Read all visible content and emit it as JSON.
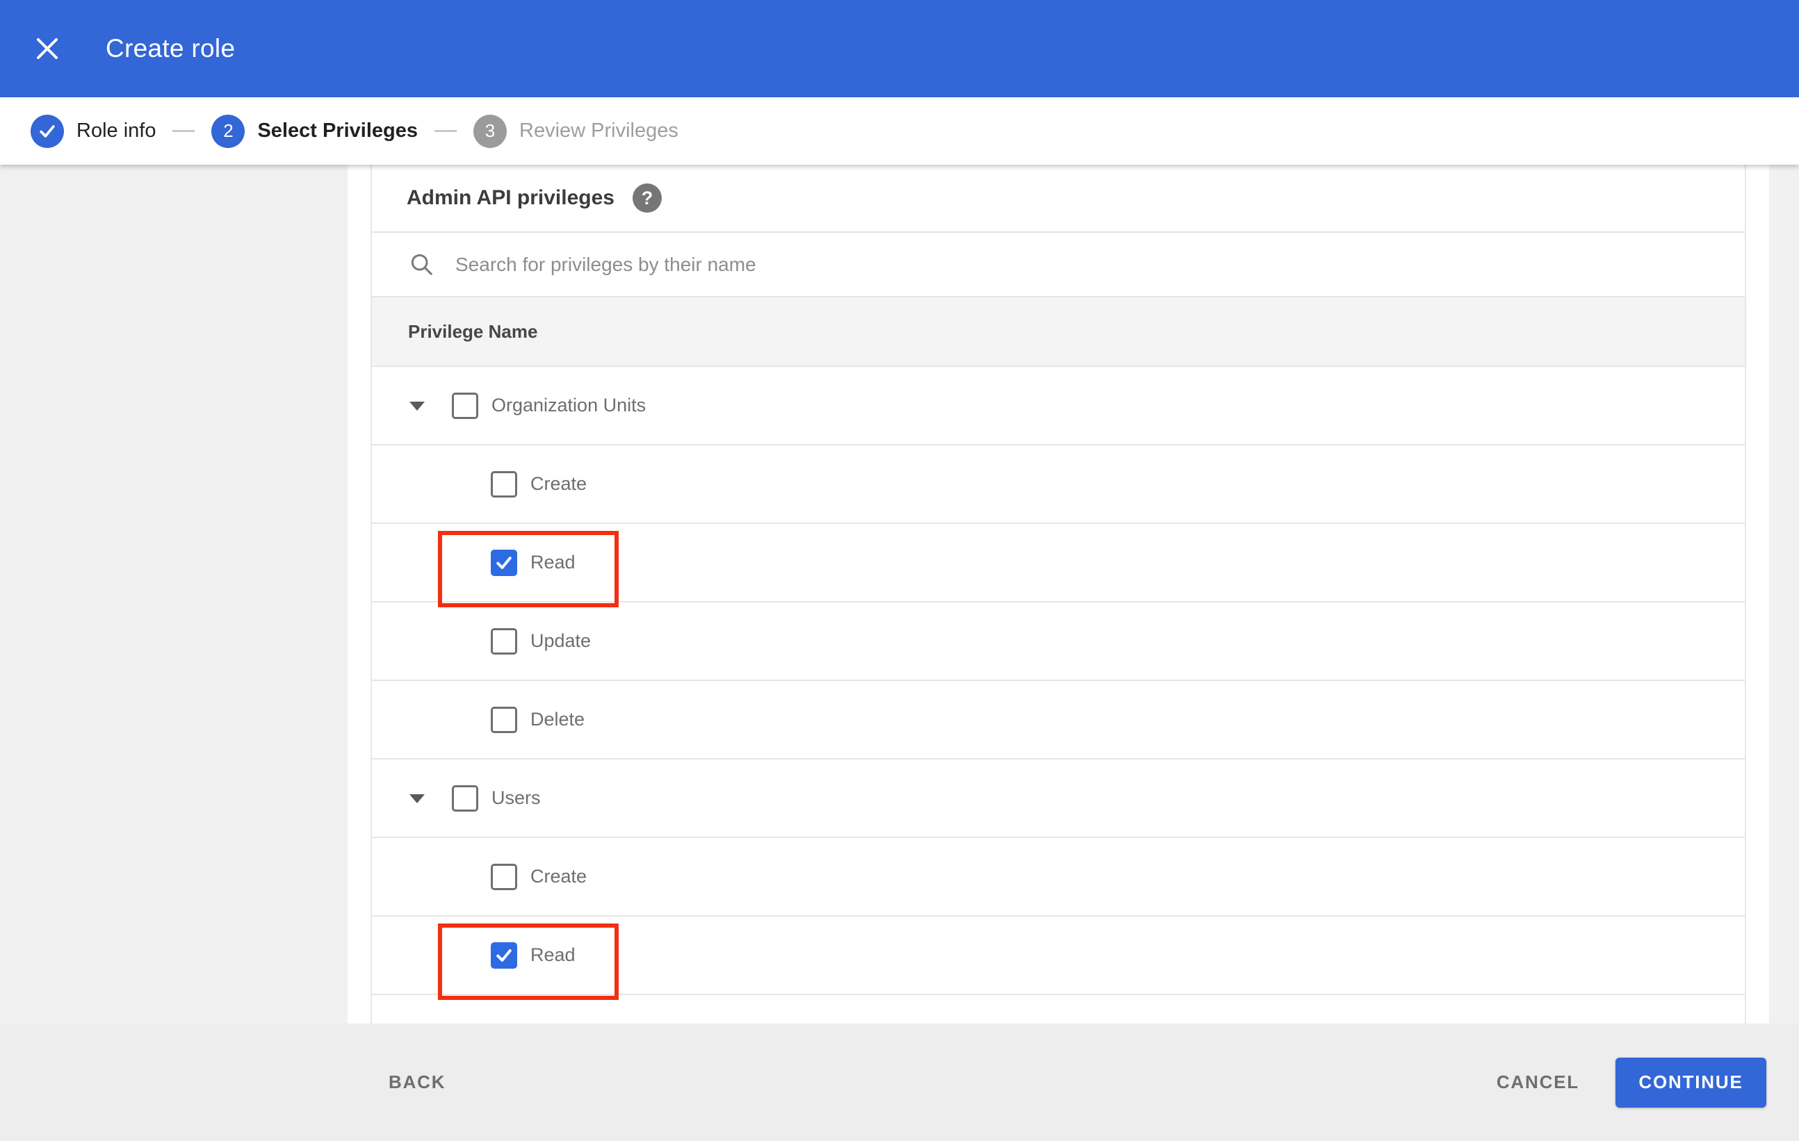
{
  "header": {
    "title": "Create role"
  },
  "stepper": {
    "steps": [
      {
        "label": "Role info",
        "status": "completed"
      },
      {
        "label": "Select Privileges",
        "status": "active",
        "number": "2"
      },
      {
        "label": "Review Privileges",
        "status": "upcoming",
        "number": "3"
      }
    ]
  },
  "main": {
    "title": "Admin API privileges",
    "help_glyph": "?",
    "search": {
      "placeholder": "Search for privileges by their name",
      "value": ""
    },
    "table": {
      "header": "Privilege Name",
      "rows": [
        {
          "label": "Organization Units",
          "level": "group",
          "checked": false,
          "expanded": true,
          "highlighted": false
        },
        {
          "label": "Create",
          "level": "child",
          "checked": false,
          "highlighted": false
        },
        {
          "label": "Read",
          "level": "child",
          "checked": true,
          "highlighted": true
        },
        {
          "label": "Update",
          "level": "child",
          "checked": false,
          "highlighted": false
        },
        {
          "label": "Delete",
          "level": "child",
          "checked": false,
          "highlighted": false
        },
        {
          "label": "Users",
          "level": "group",
          "checked": false,
          "expanded": true,
          "highlighted": false
        },
        {
          "label": "Create",
          "level": "child",
          "checked": false,
          "highlighted": false
        },
        {
          "label": "Read",
          "level": "child",
          "checked": true,
          "highlighted": true
        }
      ]
    }
  },
  "footer": {
    "back_label": "BACK",
    "cancel_label": "CANCEL",
    "continue_label": "CONTINUE"
  },
  "colors": {
    "appbar_blue": "#3366d6",
    "checkbox_blue": "#2d6be2",
    "highlight_red": "#f23011",
    "footer_gray": "#ededee"
  }
}
